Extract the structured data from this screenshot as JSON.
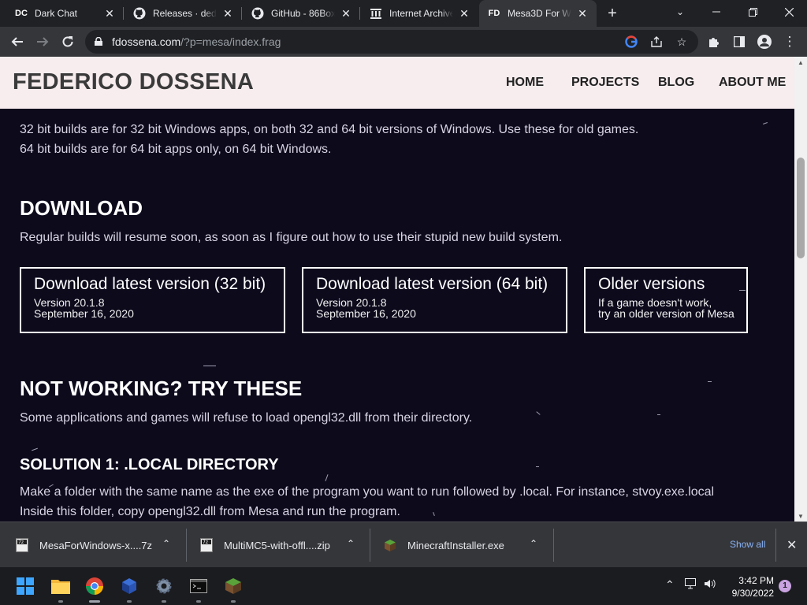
{
  "browser": {
    "tabs": [
      {
        "title": "Dark Chat",
        "favicon": "DC",
        "active": false
      },
      {
        "title": "Releases · dedej",
        "favicon": "github-icon",
        "active": false
      },
      {
        "title": "GitHub - 86Box/",
        "favicon": "github-icon",
        "active": false
      },
      {
        "title": "Internet Archive",
        "favicon": "archive-icon",
        "active": false
      },
      {
        "title": "Mesa3D For Wi",
        "favicon": "FD",
        "active": true
      }
    ],
    "url_host": "fdossena.com",
    "url_path": "/?p=mesa/index.frag"
  },
  "site": {
    "title": "FEDERICO DOSSENA",
    "nav": [
      "HOME",
      "PROJECTS",
      "BLOG",
      "ABOUT ME"
    ]
  },
  "content": {
    "intro_line1": "32 bit builds are for 32 bit Windows apps, on both 32 and 64 bit versions of Windows. Use these for old games.",
    "intro_line2": "64 bit builds are for 64 bit apps only, on 64 bit Windows.",
    "download_heading": "DOWNLOAD",
    "download_note": "Regular builds will resume soon, as soon as I figure out how to use their stupid new build system.",
    "buttons": [
      {
        "title": "Download latest version (32 bit)",
        "line1": "Version 20.1.8",
        "line2": "September 16, 2020"
      },
      {
        "title": "Download latest version (64 bit)",
        "line1": "Version 20.1.8",
        "line2": "September 16, 2020"
      },
      {
        "title": "Older versions",
        "line1": "If a game doesn't work,",
        "line2": "try an older version of Mesa"
      }
    ],
    "notworking_heading": "NOT WORKING? TRY THESE",
    "notworking_text": "Some applications and games will refuse to load opengl32.dll from their directory.",
    "solution1_heading": "SOLUTION 1: .LOCAL DIRECTORY",
    "solution1_line1": "Make a folder with the same name as the exe of the program you want to run followed by .local. For instance, stvoy.exe.local",
    "solution1_line2": "Inside this folder, copy opengl32.dll from Mesa and run the program."
  },
  "downloads": {
    "items": [
      "MesaForWindows-x....7z",
      "MultiMC5-with-offl....zip",
      "MinecraftInstaller.exe"
    ],
    "show_all": "Show all"
  },
  "taskbar": {
    "time": "3:42 PM",
    "date": "9/30/2022",
    "notifications": "1"
  }
}
